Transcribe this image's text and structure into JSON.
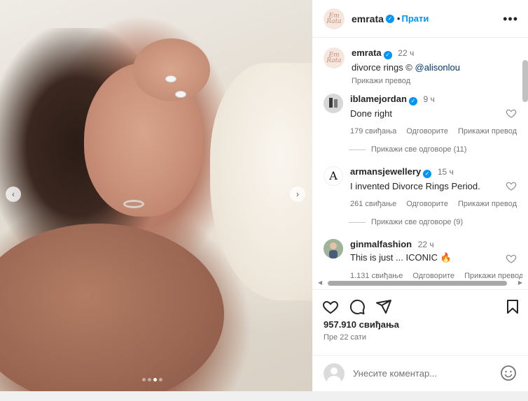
{
  "post": {
    "media": {
      "prev_label": "‹",
      "next_label": "›",
      "carousel_count": 4,
      "carousel_active": 3
    },
    "header": {
      "username": "emrata",
      "separator": "•",
      "follow_label": "Прати",
      "more_label": "•••",
      "avatar_text": "Em Rata"
    },
    "caption": {
      "username": "emrata",
      "time": "22 ч",
      "text": "divorce rings © ",
      "mention": "@alisonlou",
      "translate": "Прикажи превод"
    },
    "comments": [
      {
        "username": "iblamejordan",
        "time": "9 ч",
        "text": "Done right",
        "likes": "179 свиђања",
        "reply": "Одговорите",
        "translate": "Прикажи превод",
        "replies": "Прикажи све одговоре (11)"
      },
      {
        "username": "armansjewellery",
        "time": "15 ч",
        "text": "I invented Divorce Rings Period.",
        "likes": "261 свиђање",
        "reply": "Одговорите",
        "translate": "Прикажи превод",
        "replies": "Прикажи све одговоре (9)",
        "avatar_text": "A"
      },
      {
        "username": "ginmalfashion",
        "time": "22 ч",
        "text": "This is just ... ICONIC 🔥",
        "likes": "1.131 свиђање",
        "reply": "Одговорите",
        "translate": "Прикажи превод"
      }
    ],
    "likes_total": "957.910 свиђања",
    "posted_ago": "Пре 22 сати",
    "composer": {
      "placeholder": "Унесите коментар..."
    },
    "colors": {
      "accent": "#0095f6",
      "text": "#262626",
      "muted": "#737373"
    },
    "icons": [
      "heart-icon",
      "comment-icon",
      "share-icon",
      "bookmark-icon",
      "emoji-icon",
      "verified-icon",
      "more-icon"
    ]
  }
}
